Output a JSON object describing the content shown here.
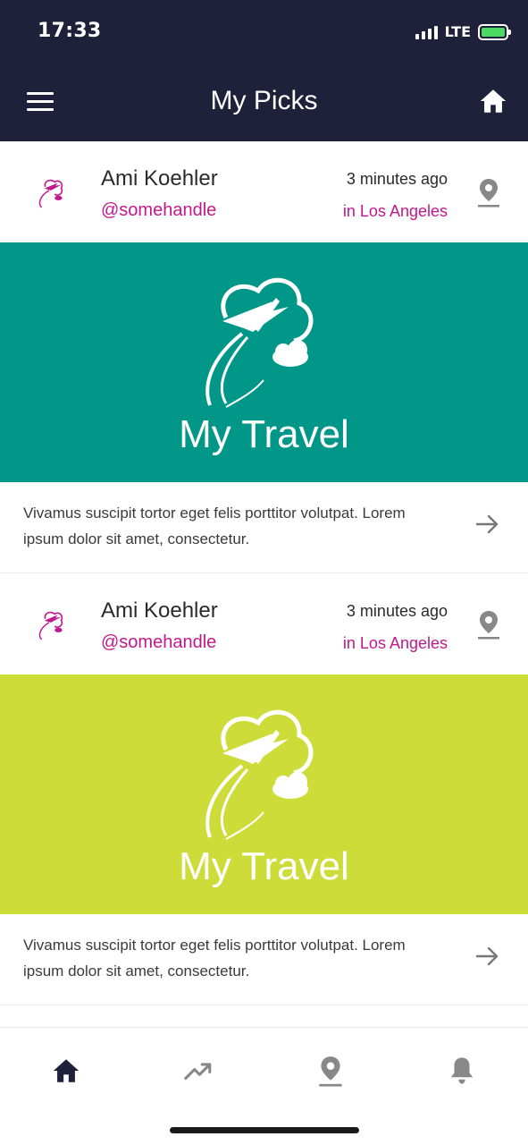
{
  "status_bar": {
    "time": "17:33",
    "network": "LTE"
  },
  "header": {
    "title": "My Picks"
  },
  "colors": {
    "navy": "#1f213a",
    "accent_magenta": "#c2188d",
    "teal": "#009688",
    "lime": "#cddc39",
    "gray_icon": "#888888"
  },
  "icons": {
    "menu": "hamburger-icon",
    "home": "home-icon",
    "pin": "location-pin-icon",
    "arrow": "arrow-right-icon",
    "trending": "trending-up-icon",
    "bell": "bell-icon"
  },
  "posts": [
    {
      "author": "Ami Koehler",
      "handle": "@somehandle",
      "time": "3 minutes ago",
      "location": "in Los Angeles",
      "banner_text": "My Travel",
      "banner_color": "#009688",
      "excerpt": "Vivamus suscipit tortor eget felis porttitor volutpat. Lorem ipsum dolor sit amet, consectetur."
    },
    {
      "author": "Ami Koehler",
      "handle": "@somehandle",
      "time": "3 minutes ago",
      "location": "in Los Angeles",
      "banner_text": "My Travel",
      "banner_color": "#cddc39",
      "excerpt": "Vivamus suscipit tortor eget felis porttitor volutpat. Lorem ipsum dolor sit amet, consectetur."
    }
  ]
}
